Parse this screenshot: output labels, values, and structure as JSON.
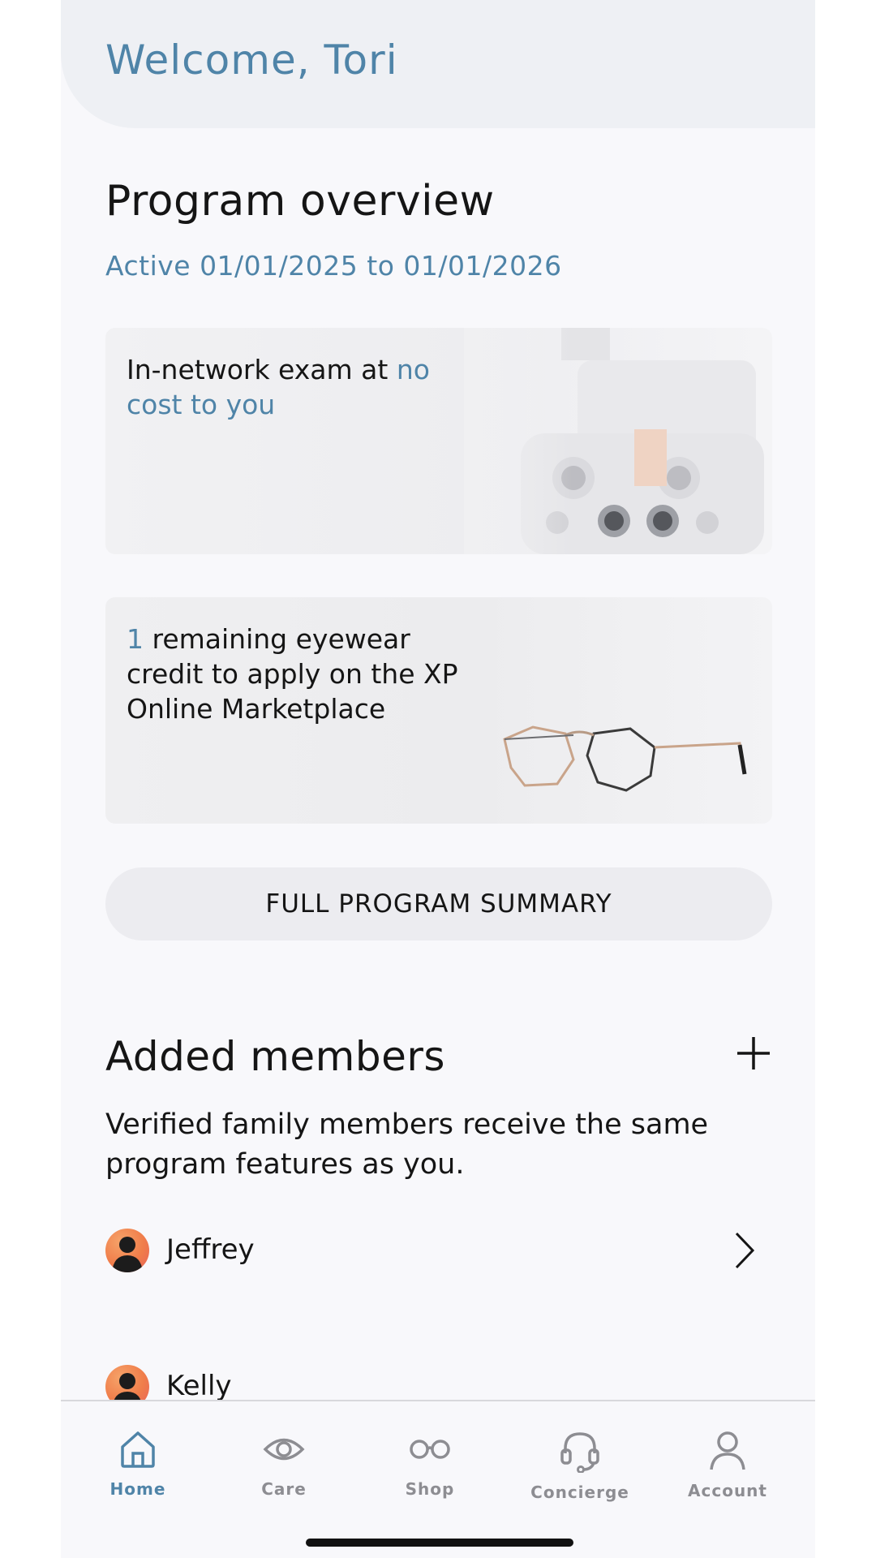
{
  "header": {
    "welcome": "Welcome, Tori"
  },
  "program": {
    "title": "Program overview",
    "active_range": "Active 01/01/2025 to 01/01/2026",
    "exam_card": {
      "text": "In-network exam at ",
      "accent": "no cost to you"
    },
    "credit_card": {
      "accent": "1",
      "text": " remaining eyewear credit to apply on the XP Online Marketplace"
    },
    "summary_button": "FULL PROGRAM SUMMARY"
  },
  "members": {
    "title": "Added members",
    "description": "Verified family members receive the same program features as you.",
    "list": [
      {
        "name": "Jeffrey"
      },
      {
        "name": "Kelly"
      }
    ]
  },
  "tabs": [
    {
      "label": "Home",
      "icon": "home-icon",
      "active": true
    },
    {
      "label": "Care",
      "icon": "eye-icon",
      "active": false
    },
    {
      "label": "Shop",
      "icon": "glasses-icon",
      "active": false
    },
    {
      "label": "Concierge",
      "icon": "headset-icon",
      "active": false
    },
    {
      "label": "Account",
      "icon": "person-icon",
      "active": false
    }
  ],
  "colors": {
    "accent": "#4f84a8",
    "text": "#151515",
    "tab_inactive": "#8d8d92"
  }
}
